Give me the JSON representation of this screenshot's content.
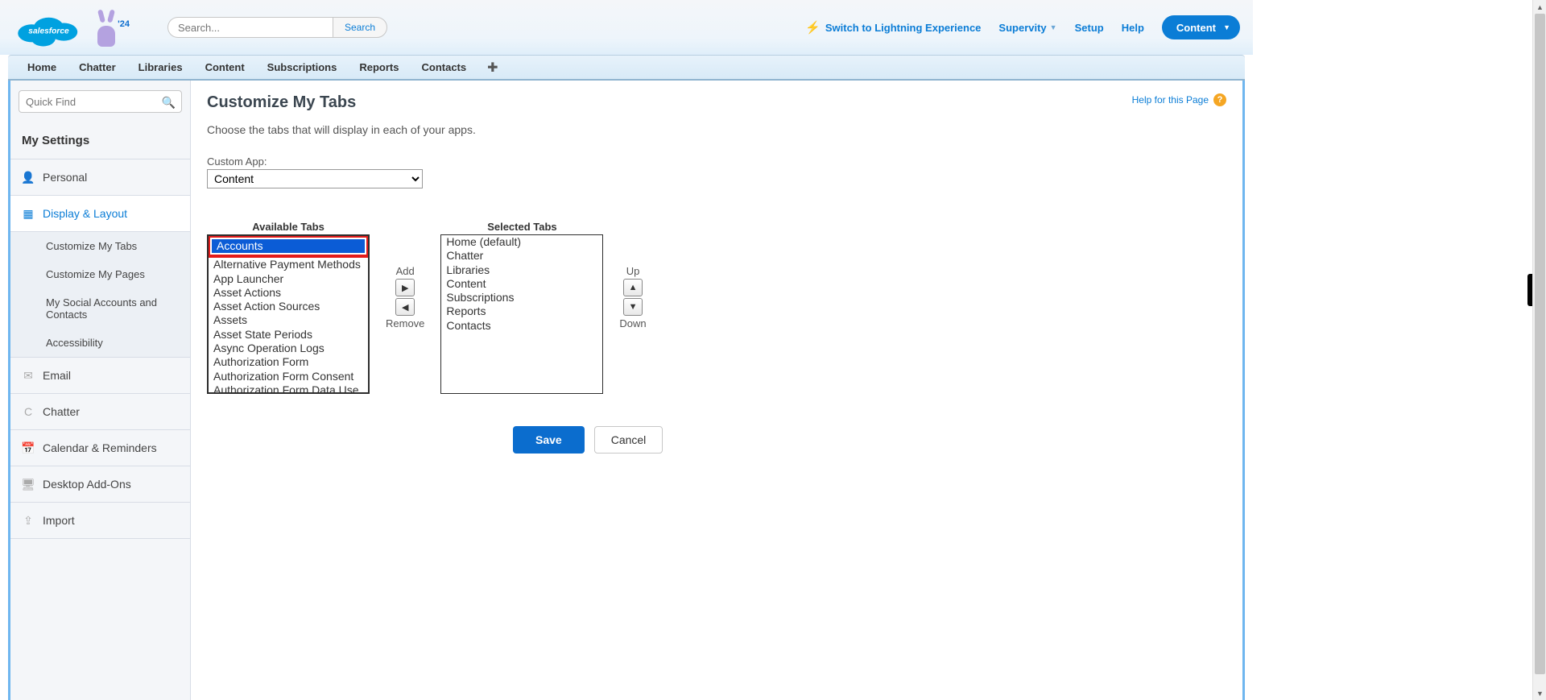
{
  "header": {
    "search_placeholder": "Search...",
    "search_button": "Search",
    "switch_lightning": "Switch to Lightning Experience",
    "user_menu": "Supervity",
    "setup": "Setup",
    "help": "Help",
    "app_pill": "Content",
    "mascot_year": "'24"
  },
  "navtabs": [
    "Home",
    "Chatter",
    "Libraries",
    "Content",
    "Subscriptions",
    "Reports",
    "Contacts"
  ],
  "sidebar": {
    "quick_find_placeholder": "Quick Find",
    "my_settings": "My Settings",
    "items": [
      {
        "label": "Personal",
        "icon": "person"
      },
      {
        "label": "Display & Layout",
        "icon": "layout",
        "active": true,
        "sub": [
          "Customize My Tabs",
          "Customize My Pages",
          "My Social Accounts and Contacts",
          "Accessibility"
        ]
      },
      {
        "label": "Email",
        "icon": "mail"
      },
      {
        "label": "Chatter",
        "icon": "chatter"
      },
      {
        "label": "Calendar & Reminders",
        "icon": "calendar"
      },
      {
        "label": "Desktop Add-Ons",
        "icon": "desktop"
      },
      {
        "label": "Import",
        "icon": "import"
      }
    ]
  },
  "main": {
    "title": "Customize My Tabs",
    "help_link": "Help for this Page",
    "description": "Choose the tabs that will display in each of your apps.",
    "custom_app_label": "Custom App:",
    "custom_app_value": "Content",
    "available_header": "Available Tabs",
    "selected_header": "Selected Tabs",
    "available_tabs": [
      "Accounts",
      "Alternative Payment Methods",
      "App Launcher",
      "Asset Actions",
      "Asset Action Sources",
      "Assets",
      "Asset State Periods",
      "Async Operation Logs",
      "Authorization Form",
      "Authorization Form Consent",
      "Authorization Form Data Use"
    ],
    "available_selected_index": 0,
    "selected_tabs": [
      "Home (default)",
      "Chatter",
      "Libraries",
      "Content",
      "Subscriptions",
      "Reports",
      "Contacts"
    ],
    "add_label": "Add",
    "remove_label": "Remove",
    "up_label": "Up",
    "down_label": "Down",
    "save": "Save",
    "cancel": "Cancel"
  }
}
